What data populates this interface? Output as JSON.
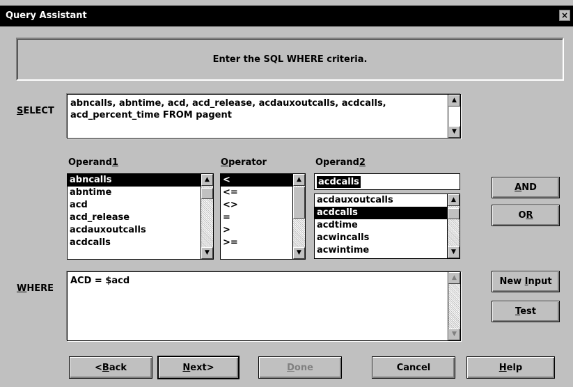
{
  "window": {
    "title": "Query Assistant",
    "close_glyph": "×"
  },
  "banner": {
    "text": "Enter the SQL WHERE criteria."
  },
  "select": {
    "label": "SELECT",
    "text": "abncalls, abntime, acd, acd_release, acdauxoutcalls, acdcalls,\nacd_percent_time FROM pagent"
  },
  "operand1": {
    "label": "Operand1",
    "items": [
      "abncalls",
      "abntime",
      "acd",
      "acd_release",
      "acdauxoutcalls",
      "acdcalls"
    ],
    "selected_index": 0
  },
  "operator": {
    "label": "Operator",
    "items": [
      "<",
      "<=",
      "<>",
      "=",
      ">",
      ">="
    ],
    "selected_index": 0
  },
  "operand2": {
    "label": "Operand2",
    "value": "acdcalls",
    "items": [
      "acdauxoutcalls",
      "acdcalls",
      "acdtime",
      "acwincalls",
      "acwintime"
    ],
    "selected_index": 1
  },
  "where": {
    "label": "WHERE",
    "text": "ACD = $acd"
  },
  "buttons": {
    "and": "AND",
    "or": "OR",
    "new_input": "New Input",
    "test": "Test",
    "back": "<Back",
    "next": "Next>",
    "done": "Done",
    "cancel": "Cancel",
    "help": "Help"
  },
  "icons": {
    "scroll_up": "▲",
    "scroll_down": "▼"
  }
}
